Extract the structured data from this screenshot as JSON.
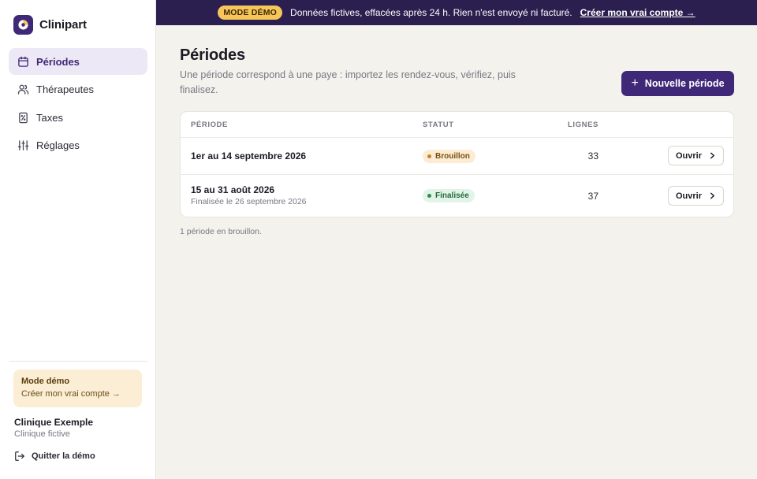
{
  "app": {
    "name": "Clinipart"
  },
  "banner": {
    "badge": "MODE DÉMO",
    "text": "Données fictives, effacées après 24 h. Rien n'est envoyé ni facturé.",
    "link": "Créer mon vrai compte →"
  },
  "sidebar": {
    "items": [
      {
        "label": "Périodes",
        "icon": "calendar-icon",
        "active": true
      },
      {
        "label": "Thérapeutes",
        "icon": "users-icon",
        "active": false
      },
      {
        "label": "Taxes",
        "icon": "tax-document-icon",
        "active": false
      },
      {
        "label": "Réglages",
        "icon": "sliders-icon",
        "active": false
      }
    ],
    "demo_card": {
      "title": "Mode démo",
      "link": "Créer mon vrai compte →"
    },
    "clinic": {
      "name": "Clinique Exemple",
      "subtitle": "Clinique fictive"
    },
    "quit_label": "Quitter la démo"
  },
  "main": {
    "title": "Périodes",
    "description": "Une période correspond à une paye : importez les rendez-vous, vérifiez, puis finalisez.",
    "new_button": "Nouvelle période",
    "table": {
      "headers": {
        "period": "PÉRIODE",
        "status": "STATUT",
        "lines": "LIGNES"
      },
      "rows": [
        {
          "period": "1er au 14 septembre 2026",
          "subtitle": "",
          "status": "Brouillon",
          "lines": "33",
          "action": "Ouvrir"
        },
        {
          "period": "15 au 31 août 2026",
          "subtitle": "Finalisée le 26 septembre 2026",
          "status": "Finalisée",
          "lines": "37",
          "action": "Ouvrir"
        }
      ]
    },
    "footnote": "1 période en brouillon."
  },
  "colors": {
    "brand": "#3f2878",
    "banner_bg": "#2a1f4e",
    "demo_badge": "#f7c65a",
    "draft": "#c5812a",
    "final": "#2f8a52"
  }
}
